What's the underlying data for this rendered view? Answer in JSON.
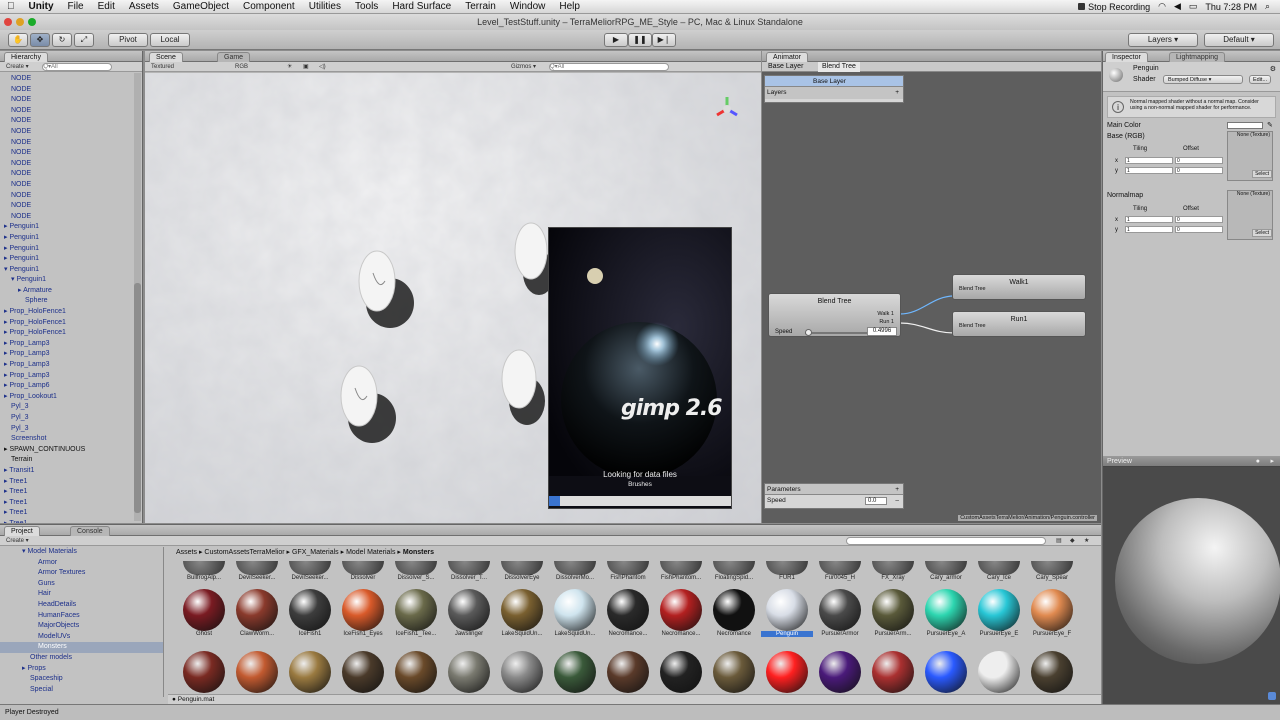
{
  "menubar": {
    "apple": "",
    "app": "Unity",
    "items": [
      "File",
      "Edit",
      "Assets",
      "GameObject",
      "Component",
      "Utilities",
      "Tools",
      "Hard Surface",
      "Terrain",
      "Window",
      "Help"
    ],
    "stop_recording": "Stop Recording",
    "clock": "Thu 7:28 PM"
  },
  "title": "Level_TestStuff.unity – TerraMeliorRPG_ME_Style – PC, Mac & Linux Standalone",
  "toolbar": {
    "pivot": "Pivot",
    "local": "Local",
    "layers": "Layers",
    "layout": "Default"
  },
  "hierarchy": {
    "tab": "Hierarchy",
    "create": "Create",
    "search_placeholder": "Q▾All",
    "rows": [
      {
        "label": "NODE",
        "indent": 1,
        "color": "blue"
      },
      {
        "label": "NODE",
        "indent": 1,
        "color": "blue"
      },
      {
        "label": "NODE",
        "indent": 1,
        "color": "blue"
      },
      {
        "label": "NODE",
        "indent": 1,
        "color": "blue"
      },
      {
        "label": "NODE",
        "indent": 1,
        "color": "blue"
      },
      {
        "label": "NODE",
        "indent": 1,
        "color": "blue"
      },
      {
        "label": "NODE",
        "indent": 1,
        "color": "blue"
      },
      {
        "label": "NODE",
        "indent": 1,
        "color": "blue"
      },
      {
        "label": "NODE",
        "indent": 1,
        "color": "blue"
      },
      {
        "label": "NODE",
        "indent": 1,
        "color": "blue"
      },
      {
        "label": "NODE",
        "indent": 1,
        "color": "blue"
      },
      {
        "label": "NODE",
        "indent": 1,
        "color": "blue"
      },
      {
        "label": "NODE",
        "indent": 1,
        "color": "blue"
      },
      {
        "label": "NODE",
        "indent": 1,
        "color": "blue"
      },
      {
        "label": "▸ Penguin1",
        "indent": 0,
        "color": "blue"
      },
      {
        "label": "▸ Penguin1",
        "indent": 0,
        "color": "blue"
      },
      {
        "label": "▸ Penguin1",
        "indent": 0,
        "color": "blue"
      },
      {
        "label": "▸ Penguin1",
        "indent": 0,
        "color": "blue"
      },
      {
        "label": "▾ Penguin1",
        "indent": 0,
        "color": "blue"
      },
      {
        "label": "▾ Penguin1",
        "indent": 1,
        "color": "blue"
      },
      {
        "label": "▸ Armature",
        "indent": 2,
        "color": "blue"
      },
      {
        "label": "Sphere",
        "indent": 3,
        "color": "blue"
      },
      {
        "label": "▸ Prop_HoloFence1",
        "indent": 0,
        "color": "blue"
      },
      {
        "label": "▸ Prop_HoloFence1",
        "indent": 0,
        "color": "blue"
      },
      {
        "label": "▸ Prop_HoloFence1",
        "indent": 0,
        "color": "blue"
      },
      {
        "label": "▸ Prop_Lamp3",
        "indent": 0,
        "color": "blue"
      },
      {
        "label": "▸ Prop_Lamp3",
        "indent": 0,
        "color": "blue"
      },
      {
        "label": "▸ Prop_Lamp3",
        "indent": 0,
        "color": "blue"
      },
      {
        "label": "▸ Prop_Lamp3",
        "indent": 0,
        "color": "blue"
      },
      {
        "label": "▸ Prop_Lamp6",
        "indent": 0,
        "color": "blue"
      },
      {
        "label": "▸ Prop_Lookout1",
        "indent": 0,
        "color": "blue"
      },
      {
        "label": "Pyl_3",
        "indent": 1,
        "color": "blue"
      },
      {
        "label": "Pyl_3",
        "indent": 1,
        "color": "blue"
      },
      {
        "label": "Pyl_3",
        "indent": 1,
        "color": "blue"
      },
      {
        "label": "Screenshot",
        "indent": 1,
        "color": "blue"
      },
      {
        "label": "▸ SPAWN_CONTINUOUS",
        "indent": 0,
        "color": "black"
      },
      {
        "label": "Terrain",
        "indent": 1,
        "color": "black"
      },
      {
        "label": "▸ Transit1",
        "indent": 0,
        "color": "blue"
      },
      {
        "label": "▸ Tree1",
        "indent": 0,
        "color": "blue"
      },
      {
        "label": "▸ Tree1",
        "indent": 0,
        "color": "blue"
      },
      {
        "label": "▸ Tree1",
        "indent": 0,
        "color": "blue"
      },
      {
        "label": "▸ Tree1",
        "indent": 0,
        "color": "blue"
      },
      {
        "label": "▸ Tree1",
        "indent": 0,
        "color": "blue"
      },
      {
        "label": "▸ Tree1",
        "indent": 0,
        "color": "blue"
      }
    ]
  },
  "scene": {
    "tab_scene": "Scene",
    "tab_game": "Game",
    "shading": "Textured",
    "render": "RGB",
    "gizmos": "Gizmos",
    "search_placeholder": "Q▾All"
  },
  "splash": {
    "logo": "gimp 2.6",
    "status": "Looking for data files",
    "substatus": "Brushes",
    "progress": 0.06
  },
  "animator": {
    "tab": "Animator",
    "crumb_base": "Base Layer",
    "crumb_tree": "Blend Tree",
    "layer_name": "Base Layer",
    "layers_label": "Layers",
    "blend_node": "Blend Tree",
    "walk_label": "Walk 1",
    "run_label": "Run 1",
    "speed_label": "Speed",
    "speed_value": "0.4996",
    "out1_title": "Walk1",
    "out1_sub": "Blend Tree",
    "out2_title": "Run1",
    "out2_sub": "Blend Tree",
    "params_label": "Parameters",
    "param_name": "Speed",
    "param_value": "0.0",
    "path": "CustomAssetsTerraMelior/Animation/Penguin.controller"
  },
  "inspector": {
    "tab_inspector": "Inspector",
    "tab_lightmapping": "Lightmapping",
    "object": "Penguin",
    "shader_label": "Shader",
    "shader_value": "Bumped Diffuse",
    "edit": "Edit...",
    "info": "Normal mapped shader without a normal map. Consider using a non-normal mapped shader for performance.",
    "main_color": "Main Color",
    "base_rgb": "Base (RGB)",
    "tiling": "Tiling",
    "offset": "Offset",
    "x": "x",
    "y": "y",
    "one": "1",
    "zero": "0",
    "none_texture": "None (Texture)",
    "select": "Select",
    "normalmap": "Normalmap"
  },
  "preview": {
    "label": "Preview"
  },
  "project": {
    "tab_project": "Project",
    "tab_console": "Console",
    "create": "Create",
    "tree": [
      {
        "label": "▾ Model Materials",
        "indent": 2
      },
      {
        "label": "Armor",
        "indent": 4
      },
      {
        "label": "Armor Textures",
        "indent": 4
      },
      {
        "label": "Guns",
        "indent": 4
      },
      {
        "label": "Hair",
        "indent": 4
      },
      {
        "label": "HeadDetails",
        "indent": 4
      },
      {
        "label": "HumanFaces",
        "indent": 4
      },
      {
        "label": "MajorObjects",
        "indent": 4
      },
      {
        "label": "ModelUVs",
        "indent": 4
      },
      {
        "label": "Monsters",
        "indent": 4,
        "selected": true
      },
      {
        "label": "Other models",
        "indent": 3
      },
      {
        "label": "▸ Props",
        "indent": 2
      },
      {
        "label": "Spaceship",
        "indent": 3
      },
      {
        "label": "Special",
        "indent": 3
      }
    ],
    "breadcrumb": [
      "Assets",
      "CustomAssetsTerraMelior",
      "GFX_Materials",
      "Model Materials",
      "Monsters"
    ],
    "row1": [
      "BullfrogAlp...",
      "DevilSeeker...",
      "DevilSeeker...",
      "Dissolver",
      "Dissolver_S...",
      "Dissolver_T...",
      "DissolverEye",
      "DissolverMo...",
      "FishPhantom",
      "FishPhantom...",
      "FloatingSpid...",
      "FUR1",
      "Fur0045_H",
      "FX_Xray",
      "Cary_armor",
      "Cary_Ice",
      "Cary_Spear"
    ],
    "row2": [
      "Ghost",
      "ClawWorm...",
      "IceFish1",
      "IceFish1_Eyes",
      "IceFish1_Tee...",
      "Jawslinger",
      "LakeSquidUn...",
      "LakeSquidUn...",
      "Necromance...",
      "Necromance...",
      "Necromance",
      "Penguin",
      "PursuerArmor",
      "PursuerArm...",
      "PursuerEye_A",
      "PursuerEye_E",
      "PursuerEye_F"
    ],
    "row2_colors": [
      "#7a1b22",
      "#8a3a2c",
      "#3d3d3d",
      "#d95a2a",
      "#6a6a4a",
      "#5a5a5a",
      "#7a6030",
      "#cfe4ee",
      "#2a2a2a",
      "#b32020",
      "#111111",
      "#d8dde6",
      "#4a4a4a",
      "#5a5a3a",
      "#2dd6b0",
      "#28c7d6",
      "#e08a50"
    ],
    "row3_colors": [
      "#7a2a22",
      "#c25a30",
      "#9a7a40",
      "#4a3a2a",
      "#6a4a2a",
      "#7a7a70",
      "#8a8a8a",
      "#3a5a3a",
      "#5a3a2a",
      "#222222",
      "#6a5a3a",
      "#ff2020",
      "#4a1a7a",
      "#aa3030",
      "#2a5aff",
      "#eeeeee",
      "#4a4030"
    ],
    "selected_file": "Penguin.mat"
  },
  "status": "Player Destroyed"
}
